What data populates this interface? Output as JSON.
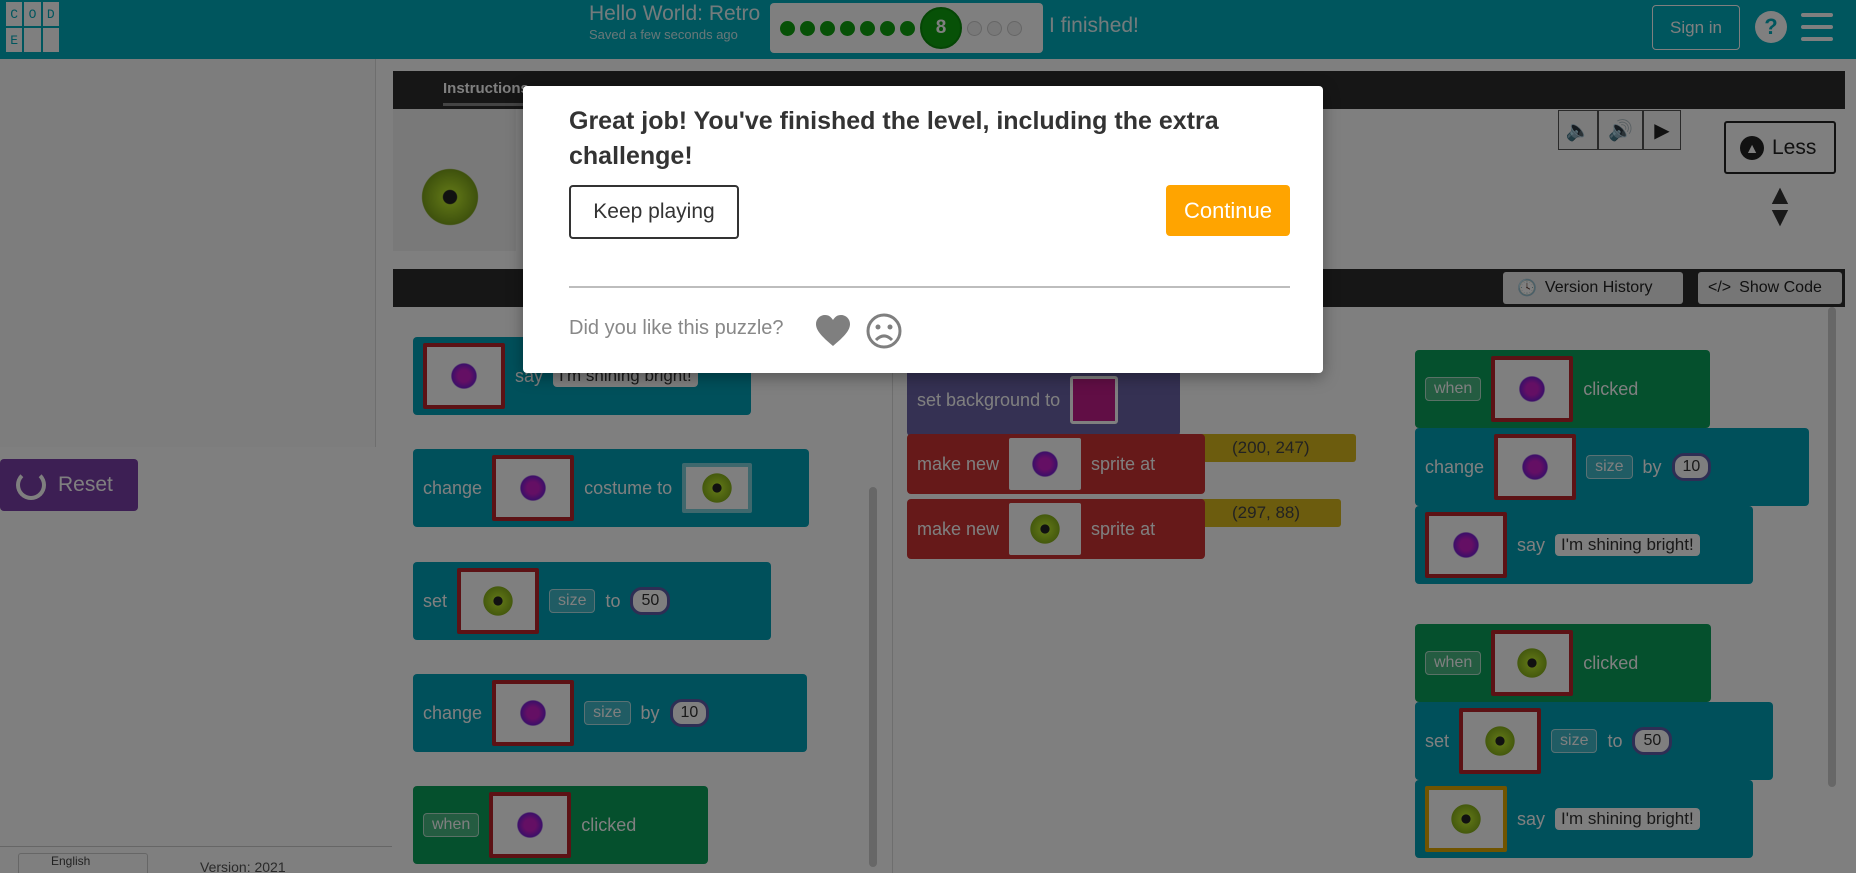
{
  "header": {
    "logo_letters": [
      "C",
      "O",
      "D",
      "E",
      "",
      ""
    ],
    "level_title": "Hello World: Retro",
    "saved_status": "Saved a few seconds ago",
    "current_level": "8",
    "finished_label": "I finished!",
    "sign_in_label": "Sign in",
    "help_label": "?"
  },
  "left_panel": {
    "reset_label": "Reset",
    "language": "English",
    "version": "Version: 2021"
  },
  "instructions": {
    "tab_label": "Instructions",
    "less_label": "Less"
  },
  "workspace_header": {
    "version_history_label": "Version History",
    "show_code_label": "Show Code"
  },
  "toolbox": {
    "blocks": [
      {
        "kw": "say",
        "text": "I'm shining bright!"
      },
      {
        "kw1": "change",
        "kw2": "costume to"
      },
      {
        "kw1": "set",
        "prop": "size",
        "kw2": "to",
        "value": "50"
      },
      {
        "kw1": "change",
        "prop": "size",
        "kw2": "by",
        "value": "10"
      },
      {
        "kw1": "when",
        "kw2": "clicked"
      }
    ]
  },
  "workspace": {
    "set_background_label": "set background to",
    "make_new_label": "make new",
    "sprite_at_label": "sprite at",
    "coord1": "(200, 247)",
    "coord2": "(297, 88)",
    "group1": {
      "when": "when",
      "clicked": "clicked",
      "change": "change",
      "prop": "size",
      "by": "by",
      "value": "10",
      "say": "say",
      "text": "I'm shining bright!"
    },
    "group2": {
      "when": "when",
      "clicked": "clicked",
      "set": "set",
      "prop": "size",
      "to": "to",
      "value": "50",
      "say": "say",
      "text": "I'm shining bright!"
    }
  },
  "modal": {
    "message": "Great job! You've finished the level, including the extra challenge!",
    "keep_playing_label": "Keep playing",
    "continue_label": "Continue",
    "feedback_question": "Did you like this puzzle?"
  },
  "colors": {
    "header_bg": "#00adbc",
    "continue_bg": "#ffa400",
    "reset_bg": "#7b3fa8",
    "block_teal": "#00a0b6",
    "block_green": "#0ba05a",
    "block_red": "#cc3333"
  }
}
